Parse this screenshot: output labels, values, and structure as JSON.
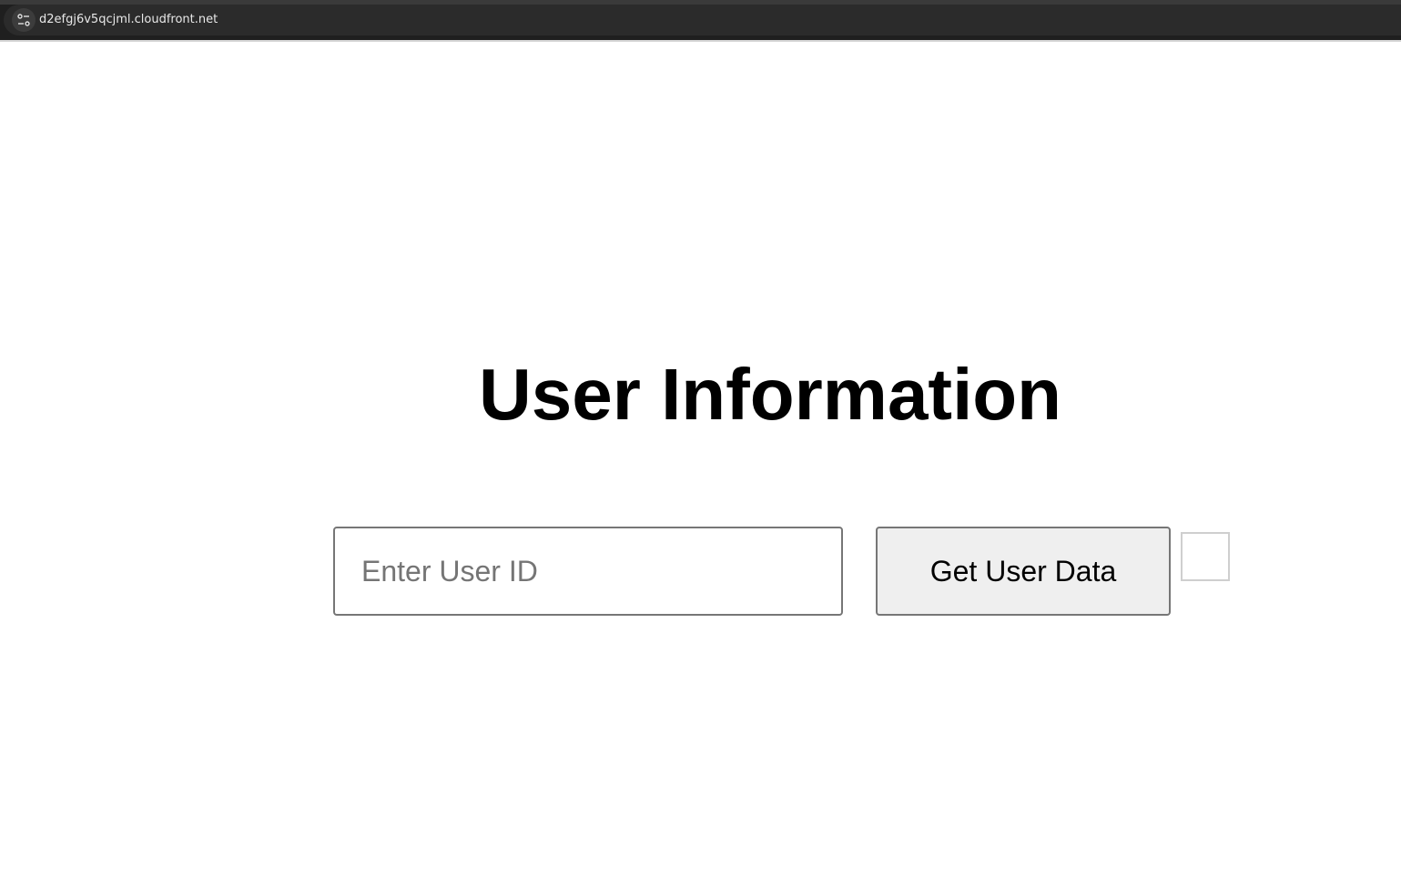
{
  "browser": {
    "url": "d2efgj6v5qcjml.cloudfront.net",
    "site_info_icon": "tune-icon"
  },
  "page": {
    "title": "User Information"
  },
  "form": {
    "user_id_placeholder": "Enter User ID",
    "user_id_value": "",
    "submit_label": "Get User Data"
  }
}
